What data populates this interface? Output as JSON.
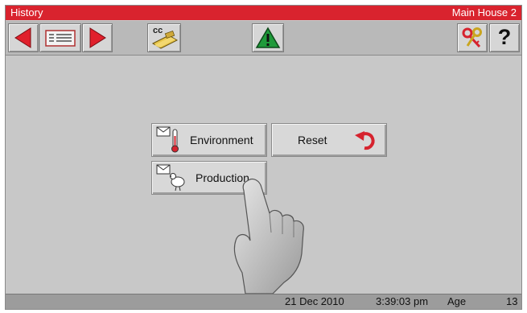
{
  "window": {
    "title": "History",
    "location": "Main House 2"
  },
  "toolbar": {
    "back_icon": "left-arrow-icon",
    "list_icon": "list-icon",
    "forward_icon": "right-arrow-icon",
    "cc_label": "cc",
    "alarm_icon": "warning-icon",
    "key_icon": "keys-icon",
    "help_label": "?"
  },
  "menu": {
    "environment_label": "Environment",
    "reset_label": "Reset",
    "production_label": "Production"
  },
  "status": {
    "date": "21 Dec 2010",
    "time": "3:39:03 pm",
    "age_label": "Age",
    "age_value": "13"
  },
  "colors": {
    "title_bar": "#d9232e",
    "arrow": "#e0202c",
    "background": "#c8c8c8"
  }
}
